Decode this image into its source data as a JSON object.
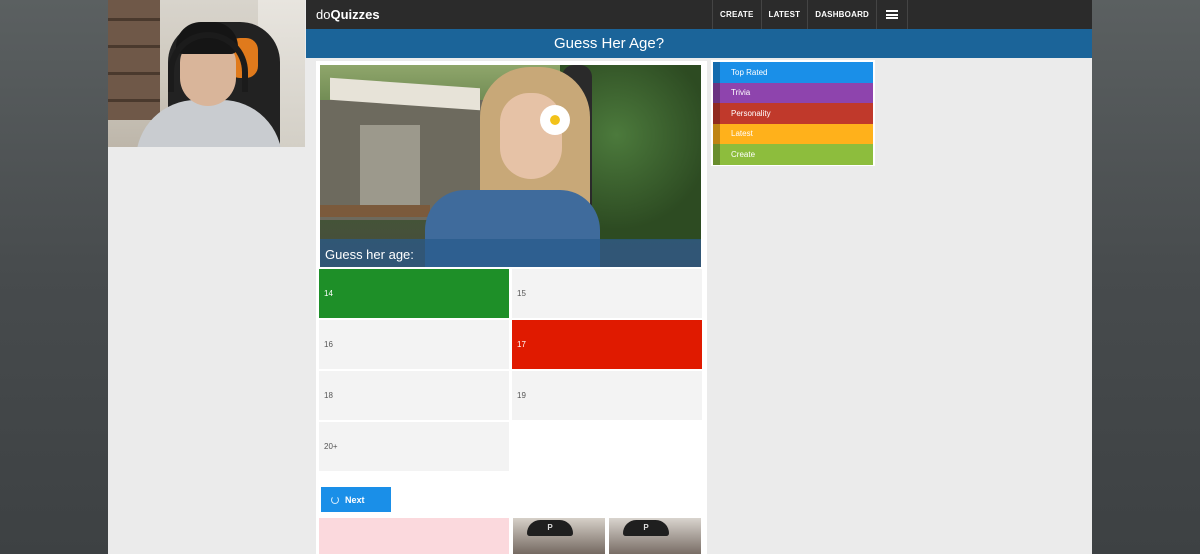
{
  "app": {
    "logo_prefix": "do",
    "logo_main": "Quizzes"
  },
  "nav": {
    "create": "CREATE",
    "latest": "LATEST",
    "dashboard": "DASHBOARD",
    "menu_icon": "hamburger-icon"
  },
  "page": {
    "title": "Guess Her Age?"
  },
  "quiz": {
    "image_description_icon": "quiz-photo",
    "caption": "Guess her age:",
    "answers": [
      {
        "label": "14",
        "state": "correct"
      },
      {
        "label": "15",
        "state": "neutral"
      },
      {
        "label": "16",
        "state": "neutral"
      },
      {
        "label": "17",
        "state": "wrong"
      },
      {
        "label": "18",
        "state": "neutral"
      },
      {
        "label": "19",
        "state": "neutral"
      },
      {
        "label": "20+",
        "state": "neutral"
      }
    ],
    "next_label": "Next",
    "thumb_letter_1": "P",
    "thumb_letter_2": "P"
  },
  "categories": [
    {
      "label": "Top Rated",
      "color": "#1a8fe8"
    },
    {
      "label": "Trivia",
      "color": "#8e44ad"
    },
    {
      "label": "Personality",
      "color": "#c0392b"
    },
    {
      "label": "Latest",
      "color": "#ffb11b"
    },
    {
      "label": "Create",
      "color": "#8dbd3d"
    }
  ],
  "colors": {
    "topbar": "#2b2b2b",
    "titlebar": "#1b6499",
    "correct": "#1e8f28",
    "wrong": "#e01a00",
    "next_button": "#1a8fe8"
  }
}
